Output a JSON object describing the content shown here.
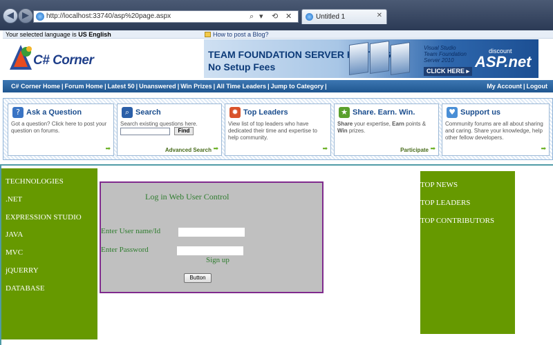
{
  "browser": {
    "address": "http://localhost:33740/asp%20page.aspx",
    "tab_title": "Untitled 1",
    "addr_tools": [
      "⌕",
      "▾",
      "⟲",
      "✕"
    ],
    "tab_close": "✕"
  },
  "lang_bar": {
    "label": "Your selected language is ",
    "value": "US English",
    "blog_link": "How to post a Blog?"
  },
  "logo": {
    "text": "C# Corner"
  },
  "ad": {
    "line1": "TEAM FOUNDATION SERVER HOSTING",
    "line2": "No Setup Fees",
    "product": "Visual Studio Team Foundation Server 2010",
    "cta": "CLICK HERE ▸",
    "discount": "discount",
    "brand": "ASP.net"
  },
  "nav": {
    "left": [
      "C# Corner Home",
      "Forum Home",
      "Latest 50",
      "Unanswered",
      "Win Prizes",
      "All Time Leaders",
      "Jump to Category"
    ],
    "right": [
      "My Account",
      "Logout"
    ],
    "separator": "|"
  },
  "features": {
    "ask": {
      "title": "Ask a Question",
      "desc": "Got a question? Click here to post your question on forums.",
      "icon": "?"
    },
    "search": {
      "title": "Search",
      "desc": "Search existing questions here.",
      "button": "Find",
      "more": "Advanced Search",
      "icon": "⌕"
    },
    "leaders": {
      "title": "Top Leaders",
      "desc": "View list of top leaders who have dedicated their time and expertise to help community.",
      "icon": "✹"
    },
    "share": {
      "title": "Share. Earn. Win.",
      "desc_1": "Share",
      "desc_2": " your expertise, ",
      "desc_3": "Earn",
      "desc_4": " points & ",
      "desc_5": "Win",
      "desc_6": " prizes.",
      "more": "Participate",
      "icon": "★"
    },
    "support": {
      "title": "Support us",
      "desc": "Community forums are all about sharing and caring. Share your knowledge, help other fellow developers.",
      "icon": "♥"
    },
    "arrow": "➡"
  },
  "left_sidebar": [
    "TECHNOLOGIES",
    ".NET",
    "EXPRESSION STUDIO",
    "JAVA",
    "MVC",
    "jQUERRY",
    "DATABASE"
  ],
  "right_sidebar": [
    "TOP NEWS",
    "TOP LEADERS",
    "TOP CONTRIBUTORS"
  ],
  "login": {
    "title": "Log in Web User Control",
    "user_label": "Enter User name/Id",
    "user_value": "",
    "pass_label": "Enter Password",
    "pass_value": "",
    "signup": "Sign up",
    "button": "Button"
  },
  "colors": {
    "sidebar_green": "#669900",
    "login_border": "#7f2a8d",
    "login_text": "#2f7d2f",
    "nav_blue": "#1f5690"
  }
}
